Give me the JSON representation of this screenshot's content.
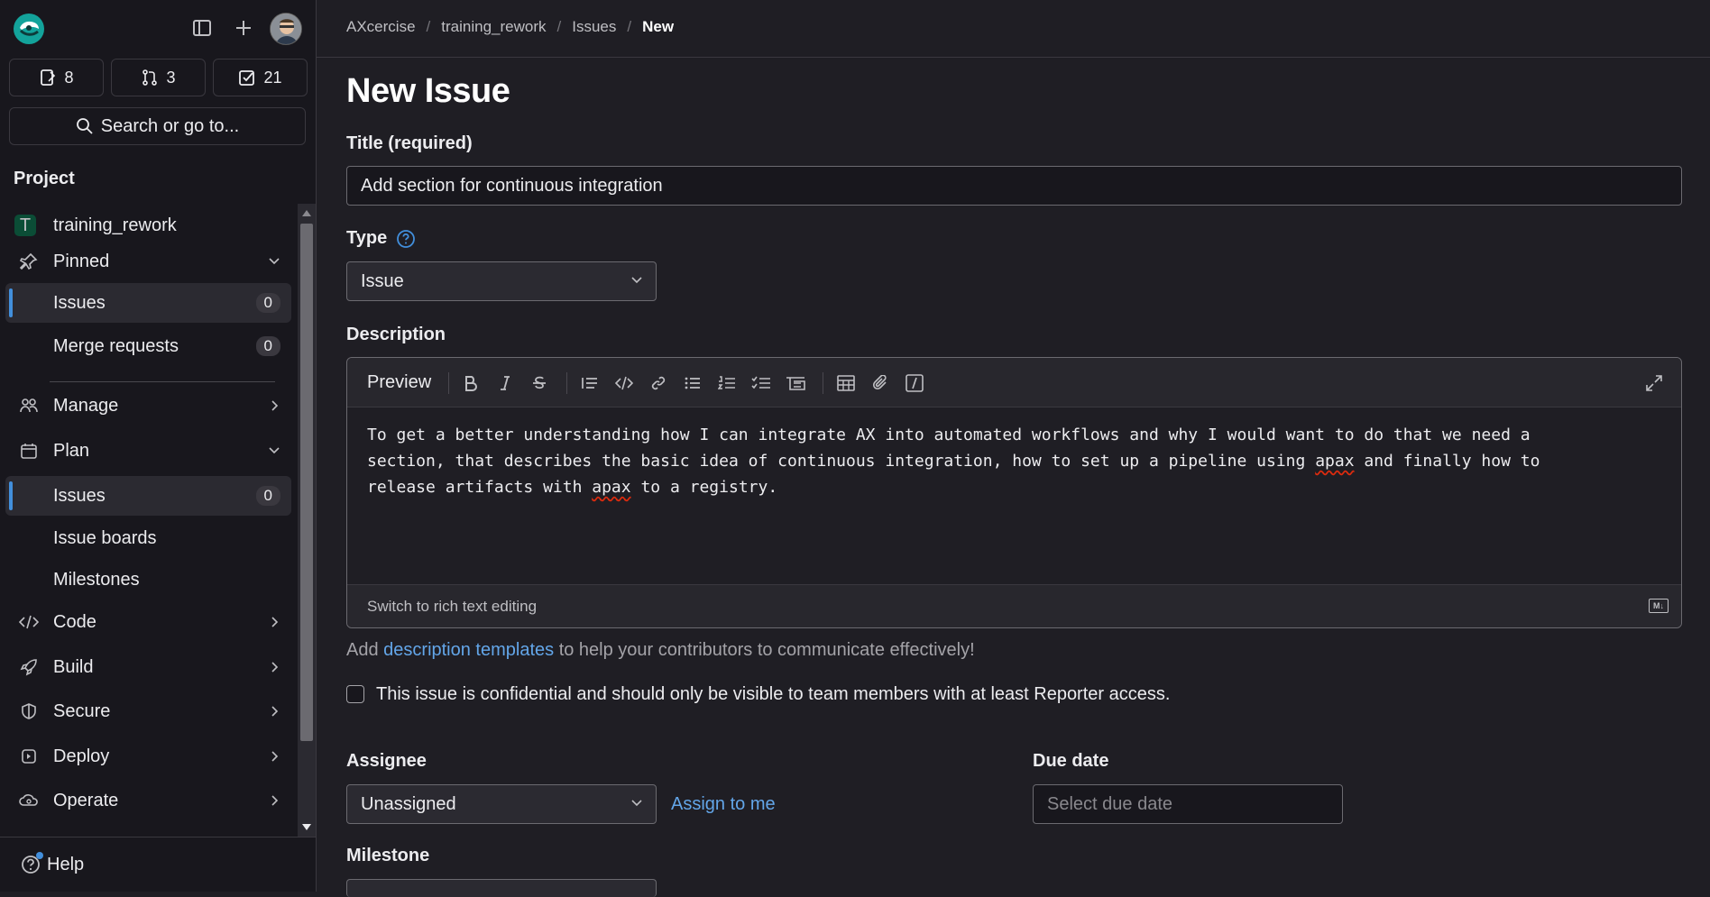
{
  "sidebar": {
    "counts": {
      "issues": "8",
      "merge_requests": "3",
      "todos": "21"
    },
    "search_label": "Search or go to...",
    "section_title": "Project",
    "project_name": "training_rework",
    "project_initial": "T",
    "pinned_label": "Pinned",
    "pinned": [
      {
        "label": "Issues",
        "badge": "0"
      },
      {
        "label": "Merge requests",
        "badge": "0"
      }
    ],
    "manage_label": "Manage",
    "plan_label": "Plan",
    "plan_items": [
      {
        "label": "Issues",
        "badge": "0"
      },
      {
        "label": "Issue boards"
      },
      {
        "label": "Milestones"
      }
    ],
    "code_label": "Code",
    "build_label": "Build",
    "secure_label": "Secure",
    "deploy_label": "Deploy",
    "operate_label": "Operate",
    "help_label": "Help"
  },
  "breadcrumb": [
    "AXcercise",
    "training_rework",
    "Issues",
    "New"
  ],
  "page_title": "New Issue",
  "form": {
    "title_label": "Title (required)",
    "title_value": "Add section for continuous integration",
    "type_label": "Type",
    "type_value": "Issue",
    "description_label": "Description",
    "preview_tab": "Preview",
    "description_text": [
      "To get a better understanding how I can integrate AX into automated workflows and why I would want to do that we need a",
      "section, that describes the basic idea of continuous integration, how to set up a pipeline using ",
      "apax",
      " and finally how to",
      "release artifacts with ",
      "apax",
      " to a registry."
    ],
    "switch_editor": "Switch to rich text editing",
    "md_badge": "M↓",
    "hint_pre": "Add ",
    "hint_link": "description templates",
    "hint_post": " to help your contributors to communicate effectively!",
    "confidential_label": "This issue is confidential and should only be visible to team members with at least Reporter access.",
    "assignee_label": "Assignee",
    "assignee_value": "Unassigned",
    "assign_to_me": "Assign to me",
    "due_label": "Due date",
    "due_placeholder": "Select due date",
    "milestone_label": "Milestone"
  },
  "colors": {
    "accent": "#428fdc",
    "link": "#63a6e9",
    "bg": "#1f1e24",
    "sidebar_bg": "#18171d"
  }
}
